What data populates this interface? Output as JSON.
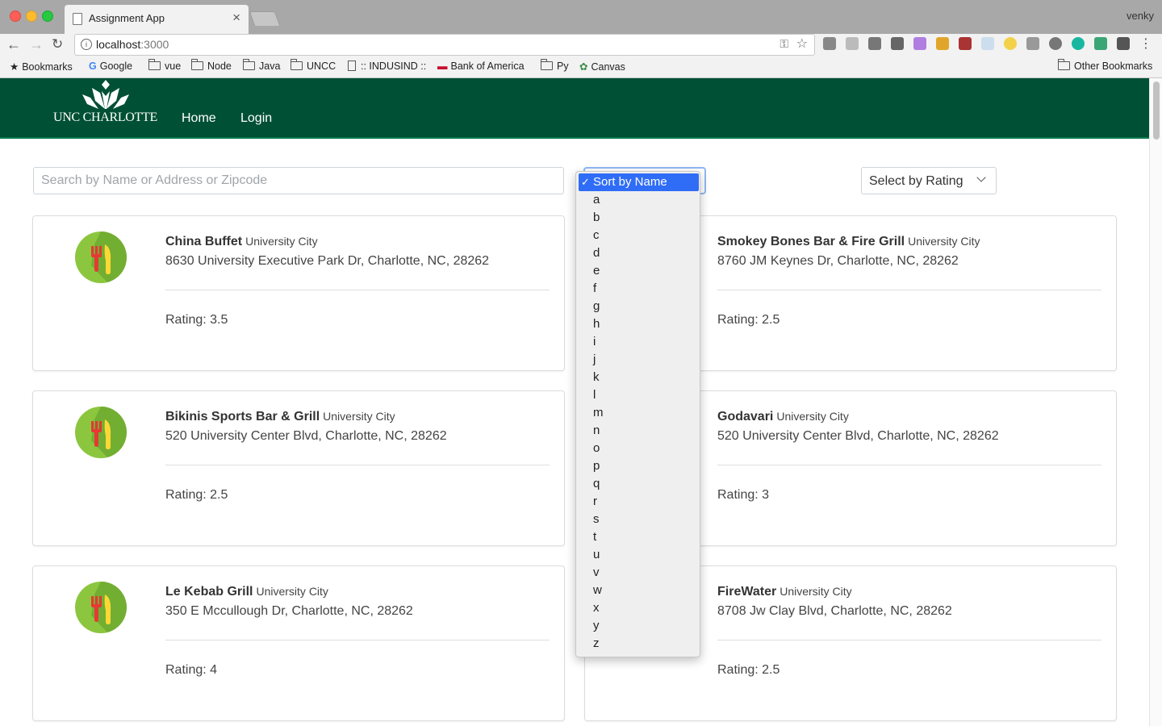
{
  "browser": {
    "tab_title": "Assignment App",
    "tab_close": "×",
    "profile_name": "venky",
    "url_host": "localhost",
    "url_port": ":3000",
    "bookmarks": [
      {
        "label": "Bookmarks",
        "icon": "star-icon"
      },
      {
        "label": "Google",
        "icon": "google-icon"
      },
      {
        "label": "vue",
        "icon": "folder-icon"
      },
      {
        "label": "Node",
        "icon": "folder-icon"
      },
      {
        "label": "Java",
        "icon": "folder-icon"
      },
      {
        "label": "UNCC",
        "icon": "folder-icon"
      },
      {
        "label": ":: INDUSIND ::",
        "icon": "page-icon"
      },
      {
        "label": "Bank of America",
        "icon": "bank-icon"
      },
      {
        "label": "Py",
        "icon": "folder-icon"
      },
      {
        "label": "Canvas",
        "icon": "canvas-icon"
      }
    ],
    "other_bookmarks": "Other Bookmarks"
  },
  "app": {
    "logo_text": "UNC CHARLOTTE",
    "nav": {
      "home": "Home",
      "login": "Login"
    },
    "brand_color": "#005035",
    "search_placeholder": "Search by Name or Address or Zipcode",
    "rating_select_label": "Select by Rating",
    "sort_dropdown": {
      "selected": "Sort by Name",
      "check": "✓",
      "options": [
        "a",
        "b",
        "c",
        "d",
        "e",
        "f",
        "g",
        "h",
        "i",
        "j",
        "k",
        "l",
        "m",
        "n",
        "o",
        "p",
        "q",
        "r",
        "s",
        "t",
        "u",
        "v",
        "w",
        "x",
        "y",
        "z"
      ]
    },
    "restaurants": [
      {
        "name": "China Buffet",
        "area": "University City",
        "address": "8630 University Executive Park Dr, Charlotte, NC, 28262",
        "rating": "Rating: 3.5"
      },
      {
        "name": "Smokey Bones Bar & Fire Grill",
        "area": "University City",
        "address": "8760 JM Keynes Dr, Charlotte, NC, 28262",
        "rating": "Rating: 2.5"
      },
      {
        "name": "Bikinis Sports Bar & Grill",
        "area": "University City",
        "address": "520 University Center Blvd, Charlotte, NC, 28262",
        "rating": "Rating: 2.5"
      },
      {
        "name": "Godavari",
        "area": "University City",
        "address": "520 University Center Blvd, Charlotte, NC, 28262",
        "rating": "Rating: 3"
      },
      {
        "name": "Le Kebab Grill",
        "area": "University City",
        "address": "350 E Mccullough Dr, Charlotte, NC, 28262",
        "rating": "Rating: 4"
      },
      {
        "name": "FireWater",
        "area": "University City",
        "address": "8708 Jw Clay Blvd, Charlotte, NC, 28262",
        "rating": "Rating: 2.5"
      }
    ]
  }
}
